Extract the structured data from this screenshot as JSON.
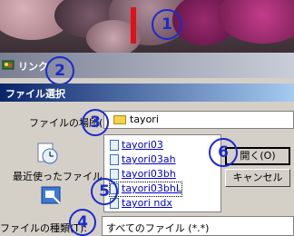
{
  "annotations": [
    "1",
    "2",
    "3",
    "4",
    "5",
    "6"
  ],
  "link_bar": {
    "label": "リンク"
  },
  "dialog": {
    "title": "ファイル選択",
    "look_in_label": "ファイルの場所(I):",
    "look_in_value": "tayori",
    "places": {
      "recent_label": "最近使ったファイル"
    },
    "files": [
      {
        "name": "tayori03"
      },
      {
        "name": "tayori03ah"
      },
      {
        "name": "tayori03bh"
      },
      {
        "name": "tayori03bhL"
      },
      {
        "name": "tayori ndx"
      }
    ],
    "open_button": "開く(O)",
    "cancel_button": "キャンセル",
    "file_type_label": "ファイルの種類(T):",
    "file_type_value": "すべてのファイル (*.*)"
  },
  "colors": {
    "annotation": "#1a2ad0",
    "marker": "#e01018",
    "title_bar": "#0a246a"
  }
}
